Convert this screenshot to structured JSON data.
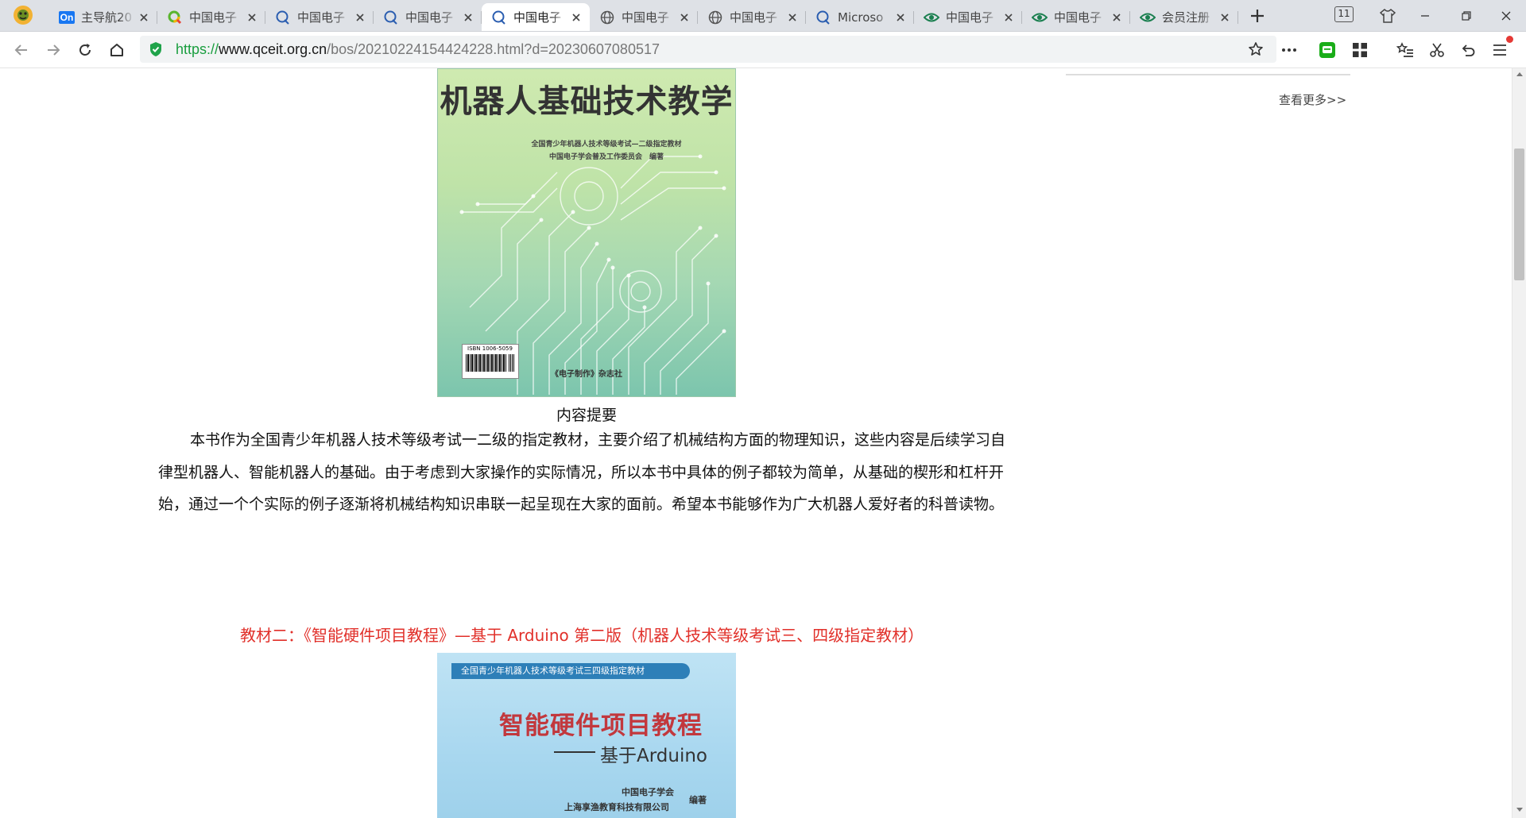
{
  "tabs": [
    {
      "label": "主导航20",
      "icon": "on-badge-icon",
      "active": false
    },
    {
      "label": "中国电子",
      "icon": "search-ring-icon",
      "active": false
    },
    {
      "label": "中国电子",
      "icon": "q-search-icon",
      "active": false
    },
    {
      "label": "中国电子",
      "icon": "q-search-icon",
      "active": false
    },
    {
      "label": "中国电子",
      "icon": "q-search-icon",
      "active": true
    },
    {
      "label": "中国电子",
      "icon": "globe-icon",
      "active": false
    },
    {
      "label": "中国电子",
      "icon": "globe-icon",
      "active": false
    },
    {
      "label": "Microso",
      "icon": "q-search-icon",
      "active": false
    },
    {
      "label": "中国电子",
      "icon": "eye-icon",
      "active": false
    },
    {
      "label": "中国电子",
      "icon": "eye-icon",
      "active": false
    },
    {
      "label": "会员注册",
      "icon": "eye-icon",
      "active": false
    }
  ],
  "tab_badge_text": "On",
  "tab_count": "11",
  "address": {
    "scheme": "https://",
    "host": "www.qceit.org.cn",
    "path": "/bos/20210224154424228.html?d=20230607080517"
  },
  "sidebar": {
    "see_more": "查看更多>>"
  },
  "book1": {
    "title": "机器人基础技术教学",
    "subtitle1": "全国青少年机器人技术等级考试—二级指定教材",
    "subtitle2": "中国电子学会普及工作委员会　编著",
    "isbn": "ISBN 1006-5059",
    "publisher": "《电子制作》杂志社"
  },
  "caption": "内容提要",
  "summary": "本书作为全国青少年机器人技术等级考试一二级的指定教材，主要介绍了机械结构方面的物理知识，这些内容是后续学习自律型机器人、智能机器人的基础。由于考虑到大家操作的实际情况，所以本书中具体的例子都较为简单，从基础的楔形和杠杆开始，通过一个个实际的例子逐渐将机械结构知识串联一起呈现在大家的面前。希望本书能够作为广大机器人爱好者的科普读物。",
  "section2_title": "教材二：《智能硬件项目教程》—基于 Arduino 第二版（机器人技术等级考试三、四级指定教材）",
  "book2": {
    "band": "全国青少年机器人技术等级考试三四级指定教材",
    "title": "智能硬件项目教程",
    "subtitle": "基于Arduino",
    "publisher1": "中国电子学会",
    "publisher2": "上海享渔教育科技有限公司",
    "edit": "编著"
  },
  "colors": {
    "accent_red": "#e1302a",
    "scheme_green": "#1a9e3f",
    "cover1_green": "#a5d8b3",
    "cover2_blue": "#a8d7ef"
  }
}
